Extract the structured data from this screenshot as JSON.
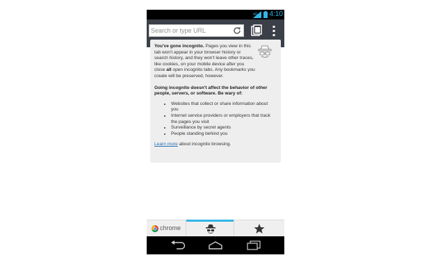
{
  "status_bar": {
    "time": "4:10",
    "accent_color": "#33b5e5"
  },
  "toolbar": {
    "url_placeholder": "Search or type URL",
    "url_value": "",
    "background_color": "#3b3f48",
    "reload_icon": "reload-icon",
    "tabs_icon": "tab-switcher-icon",
    "menu_icon": "overflow-menu-icon"
  },
  "incognito_card": {
    "icon": "incognito-icon",
    "intro_heading": "You've gone incognito.",
    "intro_body": " Pages you view in this tab won't appear in your browser history or search history, and they won't leave other traces, like cookies, on your mobile device after you close ",
    "intro_all": "all",
    "intro_tail": " open incognito tabs. Any bookmarks you create will be preserved, however.",
    "warning": "Going incognito doesn't affect the behavior of other people, servers, or software. Be wary of:",
    "warnings_list": [
      "Websites that collect or share information about you",
      "Internet service providers or employers that track the pages you visit",
      "Surveillance by secret agents",
      "People standing behind you"
    ],
    "learn_more_link": "Learn more",
    "learn_more_tail": " about incognito browsing."
  },
  "bottom_tabs": {
    "chrome_label": "chrome",
    "selected_tab": "incognito",
    "items": [
      {
        "id": "chrome",
        "icon": "chrome-logo-icon"
      },
      {
        "id": "incognito",
        "icon": "incognito-icon"
      },
      {
        "id": "bookmarks",
        "icon": "star-icon"
      }
    ],
    "selected_color": "#33b5e5"
  },
  "nav_bar": {
    "buttons": [
      {
        "id": "back",
        "icon": "back-arrow-icon"
      },
      {
        "id": "home",
        "icon": "home-icon"
      },
      {
        "id": "recents",
        "icon": "recent-apps-icon"
      }
    ]
  }
}
